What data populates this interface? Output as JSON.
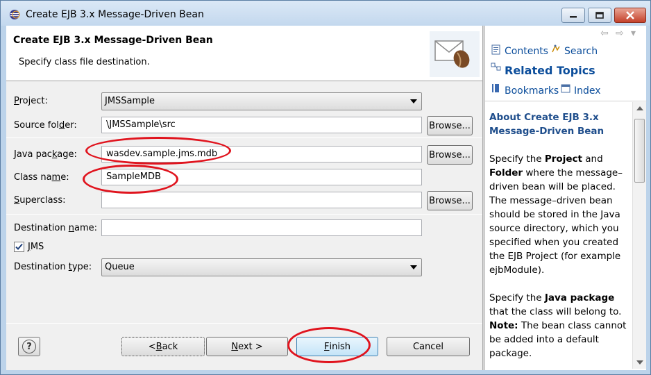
{
  "window": {
    "title": "Create EJB 3.x Message-Driven Bean"
  },
  "banner": {
    "title": "Create EJB 3.x Message-Driven Bean",
    "description": "Specify class file destination."
  },
  "form": {
    "project": {
      "label_pre": "",
      "label_u": "P",
      "label_post": "roject:",
      "value": "JMSSample"
    },
    "source_folder": {
      "label_pre": "Source fol",
      "label_u": "d",
      "label_post": "er:",
      "value": "\\JMSSample\\src",
      "browse": "Browse..."
    },
    "java_package": {
      "label_pre": "Java pac",
      "label_u": "k",
      "label_post": "age:",
      "value": "wasdev.sample.jms.mdb",
      "browse": "Browse..."
    },
    "class_name": {
      "label_pre": "Class na",
      "label_u": "m",
      "label_post": "e:",
      "value": "SampleMDB"
    },
    "superclass": {
      "label_pre": "",
      "label_u": "S",
      "label_post": "uperclass:",
      "value": "",
      "browse": "Browse..."
    },
    "destination_name": {
      "label_pre": "Destination ",
      "label_u": "n",
      "label_post": "ame:",
      "value": ""
    },
    "jms": {
      "label_pre": "",
      "label_u": "J",
      "label_post": "MS",
      "checked": true
    },
    "destination_type": {
      "label_pre": "Destination ",
      "label_u": "t",
      "label_post": "ype:",
      "value": "Queue"
    }
  },
  "buttons": {
    "back": {
      "pre": "< ",
      "u": "B",
      "post": "ack"
    },
    "next": {
      "pre": "",
      "u": "N",
      "post": "ext >"
    },
    "finish": {
      "pre": "",
      "u": "F",
      "post": "inish"
    },
    "cancel": "Cancel",
    "help": "?"
  },
  "help_panel": {
    "contents": "Contents",
    "search": "Search",
    "related_topics": "Related Topics",
    "bookmarks": "Bookmarks",
    "index": "Index",
    "heading": "About Create EJB 3.x Message-Driven Bean",
    "p1_a": "Specify the ",
    "p1_b": "Project",
    "p1_c": " and ",
    "p1_d": "Folder",
    "p1_e": " where the message–driven bean will be placed. The message–driven bean should be stored in the Java source directory, which you specified when you created the EJB Project (for example ejbModule).",
    "p2_a": "Specify the ",
    "p2_b": "Java package",
    "p2_c": " that the class will belong to. ",
    "p2_d": "Note:",
    "p2_e": " The bean class cannot be added into a default package."
  },
  "colors": {
    "annotation": "#e0141e",
    "help_link": "#0b4d9b",
    "help_heading": "#1f4e8c"
  }
}
